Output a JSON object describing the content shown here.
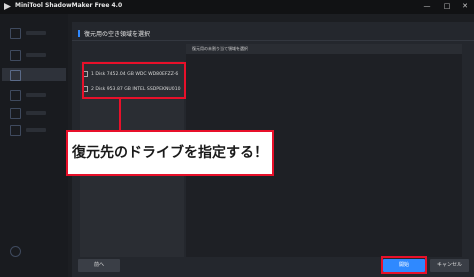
{
  "app": {
    "title": "MiniTool ShadowMaker Free 4.0"
  },
  "window_controls": {
    "minimize": "—",
    "maximize": "□",
    "close": "✕"
  },
  "dialog": {
    "title": "復元用の空き領域を選択"
  },
  "disks": [
    {
      "label": "1  Disk 7452.04 GB WDC WD80EFZZ-6"
    },
    {
      "label": "2  Disk 953.87 GB INTEL SSDPEKNU010"
    }
  ],
  "right_panel": {
    "title": "復元用の未割り当て領域を選択",
    "subtitle": ""
  },
  "annotation": {
    "text": "復元先のドライブを指定する！"
  },
  "buttons": {
    "back": "前へ",
    "start": "開始",
    "cancel": "キャンセル"
  },
  "colors": {
    "accent": "#2f89ff",
    "highlight": "#e8102a",
    "background": "#1c1e22"
  }
}
